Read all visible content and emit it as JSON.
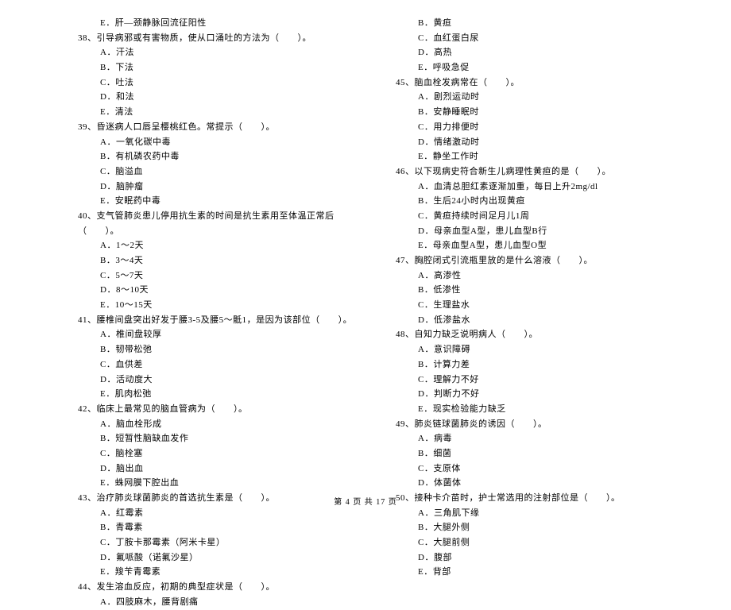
{
  "left": {
    "p0": "E．肝—颈静脉回流征阳性",
    "q38": "38、引导病邪或有害物质，使从口涌吐的方法为（　　）。",
    "q38a": "A．汗法",
    "q38b": "B．下法",
    "q38c": "C．吐法",
    "q38d": "D．和法",
    "q38e": "E．清法",
    "q39": "39、昏迷病人口唇呈樱桃红色。常提示（　　）。",
    "q39a": "A．一氧化碳中毒",
    "q39b": "B．有机磷农药中毒",
    "q39c": "C．脑溢血",
    "q39d": "D．脑肿瘤",
    "q39e": "E．安眠药中毒",
    "q40": "40、支气管肺炎患儿停用抗生素的时间是抗生素用至体温正常后（　　）。",
    "q40a": "A．1～2天",
    "q40b": "B．3～4天",
    "q40c": "C．5～7天",
    "q40d": "D．8～10天",
    "q40e": "E．10～15天",
    "q41": "41、腰椎间盘突出好发于腰3-5及腰5～骶1，是因为该部位（　　）。",
    "q41a": "A．椎间盘较厚",
    "q41b": "B．韧带松弛",
    "q41c": "C．血供差",
    "q41d": "D．活动度大",
    "q41e": "E．肌肉松弛",
    "q42": "42、临床上最常见的脑血管病为（　　）。",
    "q42a": "A．脑血栓形成",
    "q42b": "B．短暂性脑缺血发作",
    "q42c": "C．脑栓塞",
    "q42d": "D．脑出血",
    "q42e": "E．蛛网膜下腔出血",
    "q43": "43、治疗肺炎球菌肺炎的首选抗生素是（　　）。",
    "q43a": "A．红霉素",
    "q43b": "B．青霉素",
    "q43c": "C．丁胺卡那霉素（阿米卡星）",
    "q43d": "D．氟哌酸（诺氟沙星）",
    "q43e": "E．羧苄青霉素",
    "q44": "44、发生溶血反应，初期的典型症状是（　　）。",
    "q44a": "A．四肢麻木，腰背剧痛"
  },
  "right": {
    "q44b": "B．黄疸",
    "q44c": "C．血红蛋白尿",
    "q44d": "D．高热",
    "q44e": "E．呼吸急促",
    "q45": "45、脑血栓发病常在（　　）。",
    "q45a": "A．剧烈运动时",
    "q45b": "B．安静睡眠时",
    "q45c": "C．用力排便时",
    "q45d": "D．情绪激动时",
    "q45e": "E．静坐工作时",
    "q46": "46、以下现病史符合新生儿病理性黄疸的是（　　）。",
    "q46a": "A．血清总胆红素逐渐加重，每日上升2mg/dl",
    "q46b": "B．生后24小时内出现黄疸",
    "q46c": "C．黄疸持续时间足月儿1周",
    "q46d": "D．母亲血型A型，患儿血型B行",
    "q46e": "E．母亲血型A型，患儿血型O型",
    "q47": "47、胸腔闭式引流瓶里放的是什么溶液（　　）。",
    "q47a": "A．高渗性",
    "q47b": "B．低渗性",
    "q47c": "C．生理盐水",
    "q47d": "D．低渗盐水",
    "q48": "48、自知力缺乏说明病人（　　）。",
    "q48a": "A．意识障碍",
    "q48b": "B．计算力差",
    "q48c": "C．理解力不好",
    "q48d": "D．判断力不好",
    "q48e": "E．现实检验能力缺乏",
    "q49": "49、肺炎链球菌肺炎的诱因（　　）。",
    "q49a": "A．病毒",
    "q49b": "B．细菌",
    "q49c": "C．支原体",
    "q49d": "D．体菌体",
    "q50": "50、接种卡介苗时，护士常选用的注射部位是（　　）。",
    "q50a": "A．三角肌下缘",
    "q50b": "B．大腿外侧",
    "q50c": "C．大腿前侧",
    "q50d": "D．腹部",
    "q50e": "E．背部"
  },
  "footer": "第 4 页 共 17 页"
}
